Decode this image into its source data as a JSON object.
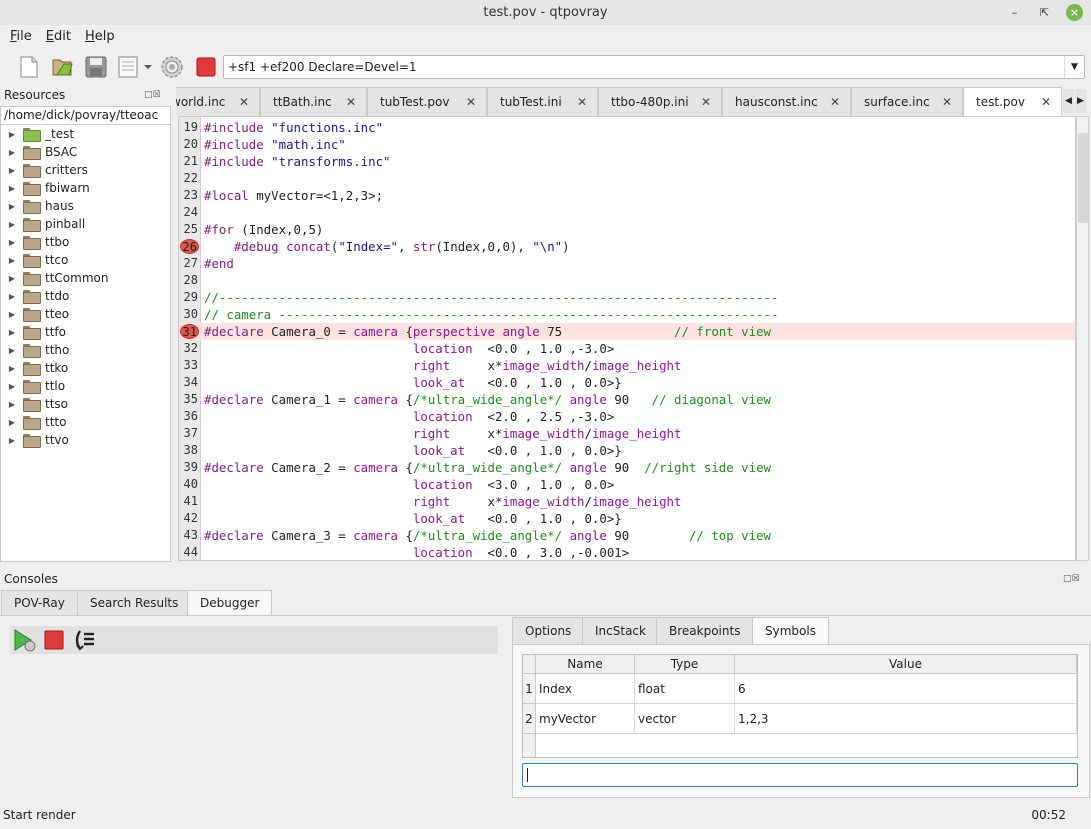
{
  "window": {
    "title": "test.pov - qtpovray"
  },
  "menu": [
    "File",
    "Edit",
    "Help"
  ],
  "toolbar": {
    "command_line": "+sf1 +ef200 Declare=Devel=1"
  },
  "resources": {
    "title": "Resources",
    "path": "/home/dick/povray/tteoac",
    "items": [
      "_test",
      "BSAC",
      "critters",
      "fbiwarn",
      "haus",
      "pinball",
      "ttbo",
      "ttco",
      "ttCommon",
      "ttdo",
      "tteo",
      "ttfo",
      "ttho",
      "ttko",
      "ttlo",
      "ttso",
      "ttto",
      "ttvo"
    ]
  },
  "editor_tabs": [
    "world.inc",
    "ttBath.inc",
    "tubTest.pov",
    "tubTest.ini",
    "ttbo-480p.ini",
    "hausconst.inc",
    "surface.inc",
    "test.pov"
  ],
  "active_tab": "test.pov",
  "code": {
    "line_numbers": [
      "19",
      "20",
      "21",
      "22",
      "23",
      "24",
      "25",
      "26",
      "27",
      "28",
      "29",
      "30",
      "31",
      "32",
      "33",
      "34",
      "35",
      "36",
      "37",
      "38",
      "39",
      "40",
      "41",
      "42",
      "43",
      "44"
    ],
    "lines": [
      "#include \"functions.inc\"",
      "#include \"math.inc\"",
      "#include \"transforms.inc\"",
      "",
      "#local myVector=<1,2,3>;",
      "",
      "#for (Index,0,5)",
      "    #debug concat(\"Index=\", str(Index,0,0), \"\\n\")",
      "#end",
      "",
      "//---------------------------------------------------------------------------",
      "// camera -------------------------------------------------------------------",
      "#declare Camera_0 = camera {perspective angle 75               // front view",
      "                            location  <0.0 , 1.0 ,-3.0>",
      "                            right     x*image_width/image_height",
      "                            look_at   <0.0 , 1.0 , 0.0>}",
      "#declare Camera_1 = camera {/*ultra_wide_angle*/ angle 90   // diagonal view",
      "                            location  <2.0 , 2.5 ,-3.0>",
      "                            right     x*image_width/image_height",
      "                            look_at   <0.0 , 1.0 , 0.0>}",
      "#declare Camera_2 = camera {/*ultra_wide_angle*/ angle 90  //right side view",
      "                            location  <3.0 , 1.0 , 0.0>",
      "                            right     x*image_width/image_height",
      "                            look_at   <0.0 , 1.0 , 0.0>}",
      "#declare Camera_3 = camera {/*ultra_wide_angle*/ angle 90        // top view",
      "                            location  <0.0 , 3.0 ,-0.001>"
    ],
    "breakpoints": [
      "26",
      "31"
    ],
    "highlighted_line": "31"
  },
  "consoles": {
    "title": "Consoles",
    "tabs": [
      "POV-Ray",
      "Search Results",
      "Debugger"
    ],
    "active_tab": "Debugger"
  },
  "debugger": {
    "tabs": [
      "Options",
      "IncStack",
      "Breakpoints",
      "Symbols"
    ],
    "active_tab": "Symbols",
    "columns": [
      "Name",
      "Type",
      "Value"
    ],
    "rows": [
      {
        "num": "1",
        "name": "Index",
        "type": "float",
        "value": "6"
      },
      {
        "num": "2",
        "name": "myVector",
        "type": "vector",
        "value": "1,2,3"
      }
    ],
    "input_value": ""
  },
  "status": {
    "message": "Start render",
    "time": "00:52"
  }
}
